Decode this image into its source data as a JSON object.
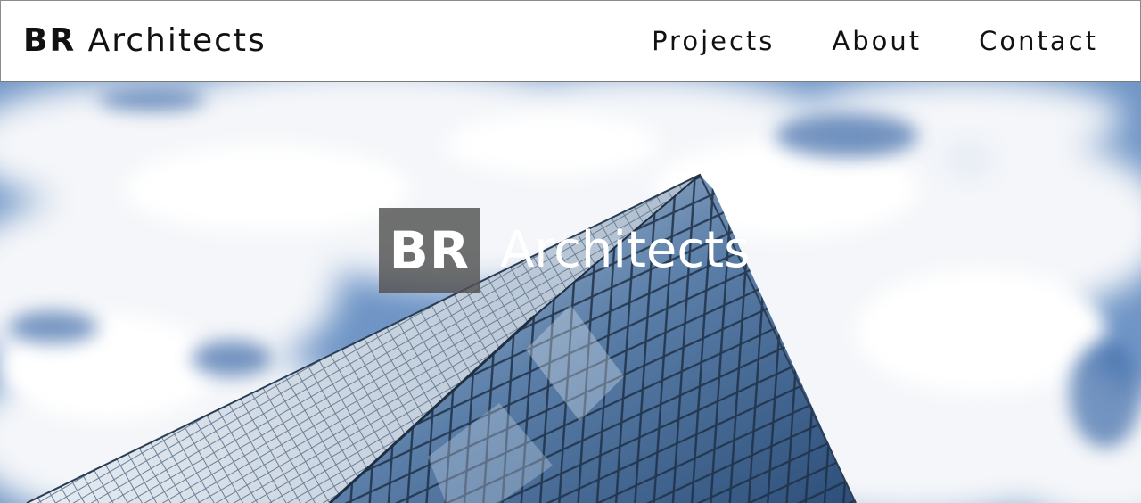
{
  "header": {
    "brand_bold": "BR",
    "brand_rest": "Architects",
    "nav": [
      "Projects",
      "About",
      "Contact"
    ]
  },
  "hero": {
    "title_bold": "BR",
    "title_rest": "Architects",
    "image_subject": "glass skyscraper against cloudy blue sky"
  },
  "colors": {
    "sky_blue": "#6f95c6",
    "cloud": "#f5f7fa",
    "overlay_box": "#505050"
  }
}
